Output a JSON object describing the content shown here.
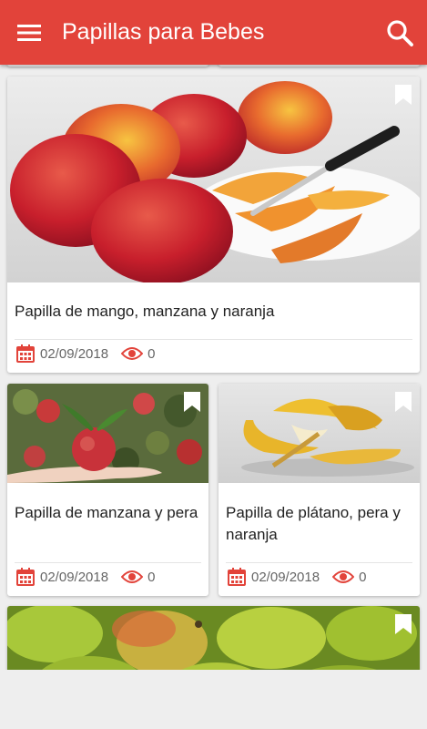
{
  "app": {
    "title": "Papillas para Bebes",
    "menu_icon": "hamburger-menu-icon",
    "search_icon": "search-icon",
    "bar_color": "#e2433a"
  },
  "recipes": [
    {
      "title": "Papilla de mango, manzana y naranja",
      "date": "02/09/2018",
      "views": "0",
      "photo": "mangoes-with-knife"
    },
    {
      "title": "Papilla de manzana y pera",
      "date": "02/09/2018",
      "views": "0",
      "photo": "apple-in-hand"
    },
    {
      "title": "Papilla de plátano, pera y naranja",
      "date": "02/09/2018",
      "views": "0",
      "photo": "bananas"
    },
    {
      "title": "",
      "date": "",
      "views": "",
      "photo": "pears"
    }
  ],
  "accent_color": "#e2433a"
}
